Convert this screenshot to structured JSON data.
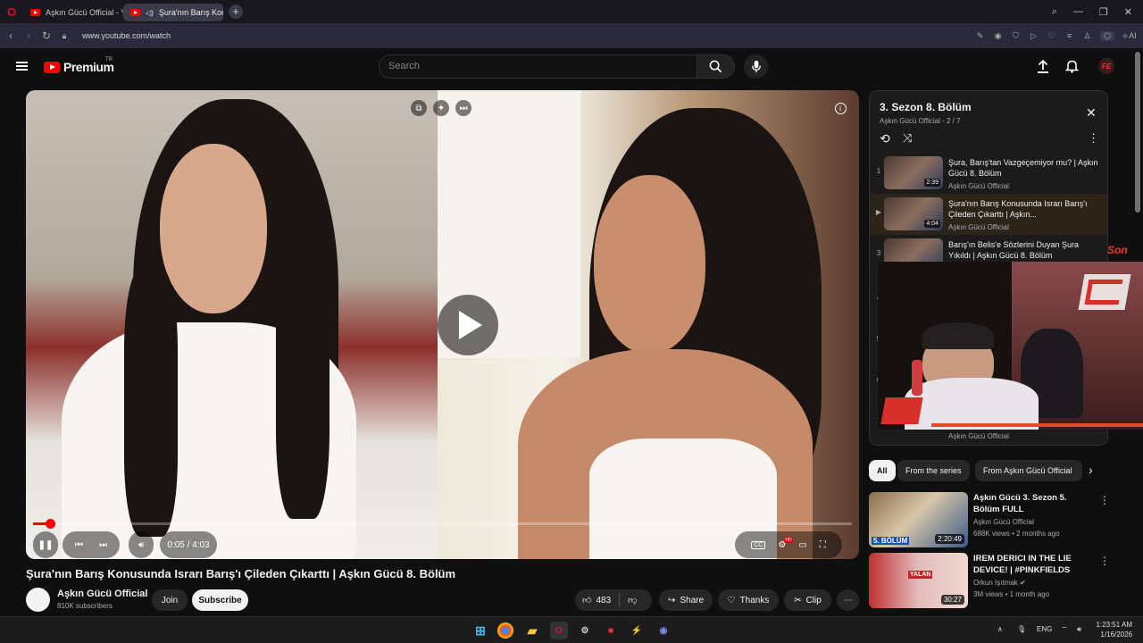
{
  "browser": {
    "tabs": [
      {
        "label": "Aşkın Gücü Official - YouTube",
        "active": false
      },
      {
        "label": "Şura'nın Barış Konusunda",
        "active": true
      }
    ],
    "url": "www.youtube.com/watch",
    "ai_label": "AI"
  },
  "header": {
    "brand": "Premium",
    "region": "TR",
    "search_placeholder": "Search"
  },
  "player": {
    "time": "0:05 / 4:03",
    "progress_fraction": 0.021
  },
  "video": {
    "title": "Şura'nın Barış Konusunda Israrı Barış'ı Çileden Çıkarttı | Aşkın Gücü 8. Bölüm",
    "channel": "Aşkın Gücü Official",
    "subscribers": "810K subscribers",
    "join": "Join",
    "subscribe": "Subscribe",
    "likes": "483",
    "share": "Share",
    "thanks": "Thanks",
    "clip": "Clip"
  },
  "playlist": {
    "title": "3. Sezon 8. Bölüm",
    "subtitle": "Aşkın Gücü Official - 2 / 7",
    "items": [
      {
        "num": "1",
        "title": "Şura, Barış'tan Vazgeçemiyor mu? | Aşkın Gücü 8. Bölüm",
        "channel": "Aşkın Gücü Official",
        "duration": "2:39"
      },
      {
        "num": "▶",
        "title": "Şura'nın Barış Konusunda Israrı Barış'ı Çileden Çıkarttı | Aşkın...",
        "channel": "Aşkın Gücü Official",
        "duration": "4:04"
      },
      {
        "num": "3",
        "title": "Barış'ın Belis'e Sözlerini Duyan Şura Yıkıldı | Aşkın Gücü 8. Bölüm",
        "channel": "",
        "duration": ""
      },
      {
        "num": "4"
      },
      {
        "num": "5"
      },
      {
        "num": "6"
      },
      {
        "num": "7",
        "channel": "Aşkın Gücü Official"
      }
    ]
  },
  "overlay": {
    "tag": "Son"
  },
  "chips": [
    "All",
    "From the series",
    "From Aşkın Gücü Official"
  ],
  "recommendations": [
    {
      "title": "Aşkın Gücü 3. Sezon 5. Bölüm FULL",
      "channel": "Aşkın Gücü Official",
      "meta": "688K views • 2 months ago",
      "duration": "2:20:49",
      "thumb_label": "5. BÖLÜM"
    },
    {
      "title": "IREM DERICI IN THE LIE DEVICE! | #PINKFIELDS",
      "channel": "Orkun Işıtmak",
      "meta": "3M views • 1 month ago",
      "duration": "30:27",
      "thumb_label": "YALAN"
    }
  ],
  "taskbar": {
    "lang": "ENG",
    "time": "1:23:51 AM",
    "date": "1/16/2026"
  }
}
